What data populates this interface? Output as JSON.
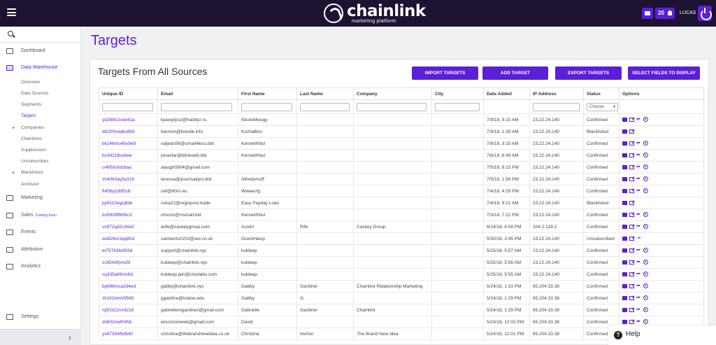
{
  "brand": {
    "name": "chainlink",
    "subtitle": "marketing platform"
  },
  "topbar": {
    "notif_count": "20",
    "user": "LUCAS"
  },
  "sidebar": {
    "items": [
      {
        "label": "Dashboard"
      },
      {
        "label": "Data Warehouse"
      },
      {
        "label": "Marketing"
      },
      {
        "label": "Sales",
        "badge": "Coming Soon"
      },
      {
        "label": "Events"
      },
      {
        "label": "Attribution"
      },
      {
        "label": "Analytics"
      },
      {
        "label": "Settings"
      }
    ],
    "subitems": [
      "Overview",
      "Data Sources",
      "Segments",
      "Targets",
      "Companies",
      "Chainlinks",
      "Suppression",
      "Unsubscribes",
      "Blacklisted",
      "Archived"
    ]
  },
  "page": {
    "title": "Targets"
  },
  "card": {
    "title": "Targets From All Sources",
    "buttons": [
      "IMPORT TARGETS",
      "ADD TARGET",
      "EXPORT TARGETS",
      "SELECT FIELDS TO DISPLAY"
    ]
  },
  "table": {
    "headers": [
      "Unique ID",
      "Email",
      "First Name",
      "Last Name",
      "Company",
      "City",
      "Date Added",
      "IP Address",
      "Status",
      "Options"
    ],
    "status_filter": "Choose",
    "rows": [
      {
        "id": "yd268n2ooe41a",
        "email": "kjuwqdysz@fraddyz.ru",
        "first": "NicoleMoogy",
        "last": "",
        "company": "",
        "city": "",
        "date": "7/9/18, 9:15 AM",
        "ip": "23.22.24.140",
        "status": "Confirmed"
      },
      {
        "id": "db200voq6o8b0",
        "email": "barnum@livesilk.info",
        "first": "KozhaBon",
        "last": "",
        "company": "",
        "city": "",
        "date": "7/9/18, 1:39 AM",
        "ip": "23.22.24.140",
        "status": "Blacklisted"
      },
      {
        "id": "bk246mo45v9e9",
        "email": "valjean56@umail4less.bid",
        "first": "KennethNut",
        "last": "",
        "company": "",
        "city": "",
        "date": "7/8/18, 3:15 AM",
        "ip": "23.22.24.140",
        "status": "Confirmed"
      },
      {
        "id": "bv3421lbxrbee",
        "email": "jonasfar@blinkweb.bid",
        "first": "KennethNut",
        "last": "",
        "company": "",
        "city": "",
        "date": "7/6/18, 6:49 AM",
        "ip": "23.22.24.140",
        "status": "Confirmed"
      },
      {
        "id": "ci495fs0dc6aa",
        "email": "alaugh0904@gmail.com",
        "first": "",
        "last": "",
        "company": "",
        "city": "",
        "date": "7/5/18, 8:23 PM",
        "ip": "23.22.24.140",
        "status": "Confirmed"
      },
      {
        "id": "zh4063ay5x319",
        "email": "teressa@yourmailpro.bid",
        "first": "Alfredsmuff",
        "last": "",
        "company": "",
        "city": "",
        "date": "7/5/18, 1:56 PM",
        "ip": "23.22.24.140",
        "status": "Confirmed"
      },
      {
        "id": "ft456yj1885c8",
        "email": "raif@80ro.eu",
        "first": "Wieeecfg",
        "last": "",
        "company": "",
        "city": "",
        "date": "7/4/18, 4:29 PM",
        "ip": "23.22.24.140",
        "status": "Confirmed"
      },
      {
        "id": "py9110egcj8de",
        "email": "ncka21@regiopost.trade",
        "first": "Easy Payday Loan",
        "last": "",
        "company": "",
        "city": "",
        "date": "7/4/18, 9:21 AM",
        "ip": "23.22.24.140",
        "status": "Blacklisted"
      },
      {
        "id": "bz6939ff806c3",
        "email": "mhorst@msmail.bid",
        "first": "KennethNut",
        "last": "",
        "company": "",
        "city": "",
        "date": "7/3/18, 7:22 PM",
        "ip": "23.22.24.140",
        "status": "Confirmed"
      },
      {
        "id": "vc872qd2s34a0",
        "email": "arife@caskeygroup.com",
        "first": "Austin",
        "last": "Rife",
        "company": "Caskey Group",
        "city": "",
        "date": "6/14/18, 4:58 PM",
        "ip": "204.2.129.2",
        "status": "Confirmed"
      },
      {
        "id": "wo826xr2qq80d",
        "email": "samburton202@aol.co.uk",
        "first": "GuestHaisp",
        "last": "",
        "company": "",
        "city": "",
        "date": "5/30/18, 3:45 PM",
        "ip": "23.22.24.140",
        "status": "Unsubscribed"
      },
      {
        "id": "et75763fe993d",
        "email": "support@chainlink.nyc",
        "first": "kuldeep",
        "last": "",
        "company": "",
        "city": "",
        "date": "5/25/18, 5:57 AM",
        "ip": "23.22.24.140",
        "status": "Confirmed"
      },
      {
        "id": "zc8543frjmc5f",
        "email": "kuldeep@chainlink.nyc",
        "first": "kuldeep",
        "last": "",
        "company": "",
        "city": "",
        "date": "5/25/18, 5:56 AM",
        "ip": "23.22.24.140",
        "status": "Confirmed"
      },
      {
        "id": "cq335atl9mc8d",
        "email": "kuldeep.jain@cisinlabs.com",
        "first": "kuldeep",
        "last": "",
        "company": "",
        "city": "",
        "date": "5/25/18, 5:55 AM",
        "ip": "23.22.24.140",
        "status": "Confirmed"
      },
      {
        "id": "by698mca334ed",
        "email": "gabby@chainlink.nyc",
        "first": "Gabby",
        "last": "Gardiner",
        "company": "Chainlink Relationship Marketing",
        "city": "",
        "date": "5/24/18, 1:31 PM",
        "ip": "65.204.33.38",
        "status": "Confirmed"
      },
      {
        "id": "zk191bmlv9565",
        "email": "ggardine@tulane.edu",
        "first": "Gabby",
        "last": "G.",
        "company": "",
        "city": "",
        "date": "5/24/18, 1:29 PM",
        "ip": "65.204.33.38",
        "status": "Confirmed"
      },
      {
        "id": "nj30321mr4216",
        "email": "gabriellemgardiner@gmail.com",
        "first": "Gabrielle",
        "last": "Gardiner",
        "company": "Chainlink",
        "city": "",
        "date": "5/24/18, 1:29 PM",
        "ip": "65.204.33.38",
        "status": "Confirmed"
      },
      {
        "id": "zb602nwf045b",
        "email": "wisconsinweb@gmail.com",
        "first": "David",
        "last": "",
        "company": "",
        "city": "",
        "date": "5/24/18, 12:03 PM",
        "ip": "65.204.33.38",
        "status": "Confirmed"
      },
      {
        "id": "ys87394ffxt840",
        "email": "christina@thebrandnewidea.co.uk",
        "first": "Christina",
        "last": "Horton",
        "company": "The Brand New Idea",
        "city": "",
        "date": "5/24/18, 12:01 PM",
        "ip": "65.204.33.38",
        "status": "Confirmed"
      }
    ]
  },
  "help": {
    "label": "Help"
  }
}
